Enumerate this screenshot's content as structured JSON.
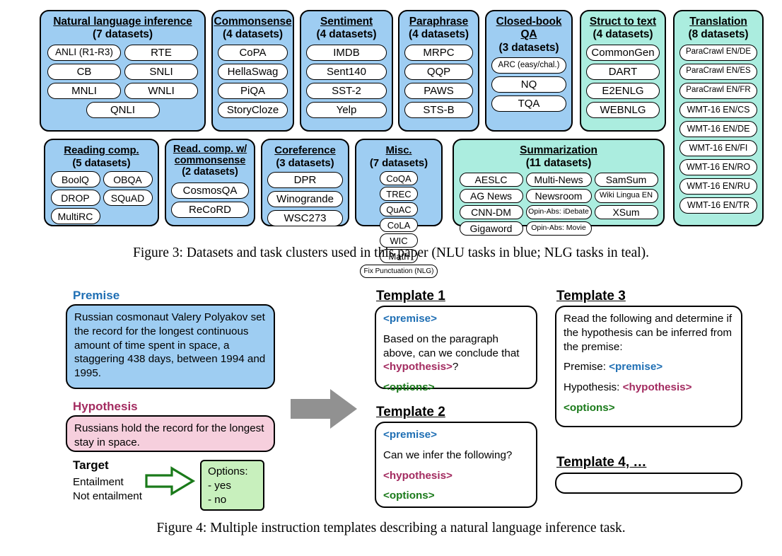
{
  "figure3": {
    "caption": "Figure 3: Datasets and task clusters used in this paper (NLU tasks in blue; NLG tasks in teal).",
    "colors": {
      "nlu_blue": "#9ecdf2",
      "nlg_teal": "#abeddf",
      "pill_white": "#ffffff",
      "border": "#000000"
    },
    "clusters": [
      {
        "title": "Natural language inference",
        "subtitle": "(7 datasets)",
        "type": "nlu",
        "datasets": [
          "ANLI (R1-R3)",
          "RTE",
          "CB",
          "SNLI",
          "MNLI",
          "WNLI",
          "QNLI"
        ]
      },
      {
        "title": "Commonsense",
        "subtitle": "(4 datasets)",
        "type": "nlu",
        "datasets": [
          "CoPA",
          "HellaSwag",
          "PiQA",
          "StoryCloze"
        ]
      },
      {
        "title": "Sentiment",
        "subtitle": "(4 datasets)",
        "type": "nlu",
        "datasets": [
          "IMDB",
          "Sent140",
          "SST-2",
          "Yelp"
        ]
      },
      {
        "title": "Paraphrase",
        "subtitle": "(4 datasets)",
        "type": "nlu",
        "datasets": [
          "MRPC",
          "QQP",
          "PAWS",
          "STS-B"
        ]
      },
      {
        "title": "Closed-book QA",
        "subtitle": "(3 datasets)",
        "type": "nlu",
        "datasets": [
          "ARC (easy/chal.)",
          "NQ",
          "TQA"
        ]
      },
      {
        "title": "Struct to text",
        "subtitle": "(4 datasets)",
        "type": "nlg",
        "datasets": [
          "CommonGen",
          "DART",
          "E2ENLG",
          "WEBNLG"
        ]
      },
      {
        "title": "Translation",
        "subtitle": "(8 datasets)",
        "type": "nlg",
        "datasets": [
          "ParaCrawl EN/DE",
          "ParaCrawl EN/ES",
          "ParaCrawl EN/FR",
          "WMT-16 EN/CS",
          "WMT-16 EN/DE",
          "WMT-16 EN/FI",
          "WMT-16 EN/RO",
          "WMT-16 EN/RU",
          "WMT-16 EN/TR"
        ]
      },
      {
        "title": "Reading comp.",
        "subtitle": "(5 datasets)",
        "type": "nlu",
        "datasets": [
          "BoolQ",
          "OBQA",
          "DROP",
          "SQuAD",
          "MultiRC"
        ]
      },
      {
        "title": "Read. comp. w/ commonsense",
        "subtitle": "(2 datasets)",
        "type": "nlu",
        "datasets": [
          "CosmosQA",
          "ReCoRD"
        ]
      },
      {
        "title": "Coreference",
        "subtitle": "(3 datasets)",
        "type": "nlu",
        "datasets": [
          "DPR",
          "Winogrande",
          "WSC273"
        ]
      },
      {
        "title": "Misc.",
        "subtitle": "(7 datasets)",
        "type": "nlu",
        "datasets": [
          "CoQA",
          "TREC",
          "QuAC",
          "CoLA",
          "WIC",
          "Math",
          "Fix Punctuation (NLG)"
        ]
      },
      {
        "title": "Summarization",
        "subtitle": "(11 datasets)",
        "type": "nlg",
        "datasets": [
          "AESLC",
          "Multi-News",
          "SamSum",
          "AG News",
          "Newsroom",
          "Wiki Lingua EN",
          "CNN-DM",
          "Opin-Abs: iDebate",
          "XSum",
          "Gigaword",
          "Opin-Abs: Movie"
        ]
      }
    ]
  },
  "figure4": {
    "caption": "Figure 4: Multiple instruction templates describing a natural language inference task.",
    "colors": {
      "premise_blue": "#9ecdf2",
      "hypothesis_pink": "#f6cfdd",
      "options_green": "#c8f0bd",
      "premise_kw": "#1f6fb4",
      "hypothesis_kw": "#a32b60",
      "options_kw": "#1a7a1a",
      "arrow_gray": "#919191",
      "arrow_green": "#1a7a1a"
    },
    "left": {
      "premise_label": "Premise",
      "premise_text": "Russian cosmonaut Valery Polyakov set the record for the longest continuous amount of time spent in space, a staggering 438 days, between 1994 and 1995.",
      "hypothesis_label": "Hypothesis",
      "hypothesis_text": "Russians hold the record for the longest stay in space.",
      "target_label": "Target",
      "target_values": [
        "Entailment",
        "Not entailment"
      ],
      "options_title": "Options:",
      "options_items": [
        "-  yes",
        "-  no"
      ]
    },
    "templates": [
      {
        "title": "Template 1",
        "lines": [
          [
            {
              "t": "<premise>",
              "k": "premise"
            }
          ],
          [
            {
              "t": "Based on the paragraph above, can we conclude that ",
              "k": "plain"
            },
            {
              "t": "<hypothesis>",
              "k": "hypothesis"
            },
            {
              "t": "?",
              "k": "plain"
            }
          ],
          [
            {
              "t": "<options>",
              "k": "options"
            }
          ]
        ]
      },
      {
        "title": "Template 2",
        "lines": [
          [
            {
              "t": "<premise>",
              "k": "premise"
            }
          ],
          [
            {
              "t": "Can we infer the following?",
              "k": "plain"
            }
          ],
          [
            {
              "t": "<hypothesis>",
              "k": "hypothesis"
            }
          ],
          [
            {
              "t": "<options>",
              "k": "options"
            }
          ]
        ]
      },
      {
        "title": "Template 3",
        "lines": [
          [
            {
              "t": "Read the following and determine if the hypothesis can be inferred from the premise:",
              "k": "plain"
            }
          ],
          [
            {
              "t": "Premise: ",
              "k": "plain"
            },
            {
              "t": "<premise>",
              "k": "premise"
            }
          ],
          [
            {
              "t": "Hypothesis: ",
              "k": "plain"
            },
            {
              "t": "<hypothesis>",
              "k": "hypothesis"
            }
          ],
          [
            {
              "t": "<options>",
              "k": "options"
            }
          ]
        ]
      },
      {
        "title": "Template 4, …",
        "lines": []
      }
    ]
  }
}
